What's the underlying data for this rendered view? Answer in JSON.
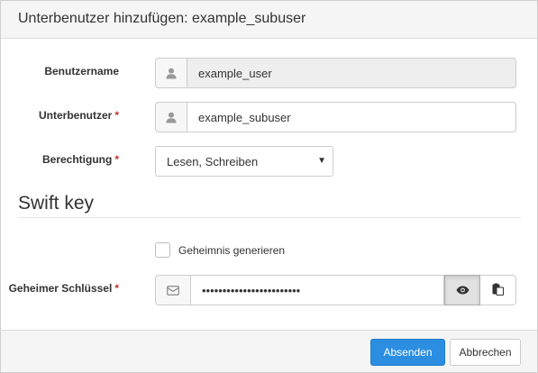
{
  "modal": {
    "title": "Unterbenutzer hinzufügen: example_subuser"
  },
  "form": {
    "username": {
      "label": "Benutzername",
      "value": "example_user",
      "readonly": true,
      "icon": "user-icon"
    },
    "subuser": {
      "label": "Unterbenutzer",
      "required_mark": "*",
      "value": "example_subuser",
      "icon": "user-icon"
    },
    "permission": {
      "label": "Berechtigung",
      "required_mark": "*",
      "selected": "Lesen, Schreiben"
    }
  },
  "swift": {
    "section_title": "Swift key",
    "generate_secret": {
      "label": "Geheimnis generieren",
      "checked": false
    },
    "secret_key": {
      "label": "Geheimer Schlüssel",
      "required_mark": "*",
      "masked_value": "••••••••••••••••••••••••",
      "icon": "envelope-icon",
      "show_icon": "eye-icon",
      "copy_icon": "clipboard-icon"
    }
  },
  "footer": {
    "submit_label": "Absenden",
    "cancel_label": "Abbrechen"
  },
  "colors": {
    "primary": "#2b8ee0",
    "required": "#c9302c",
    "header_bg": "#f5f5f5"
  }
}
